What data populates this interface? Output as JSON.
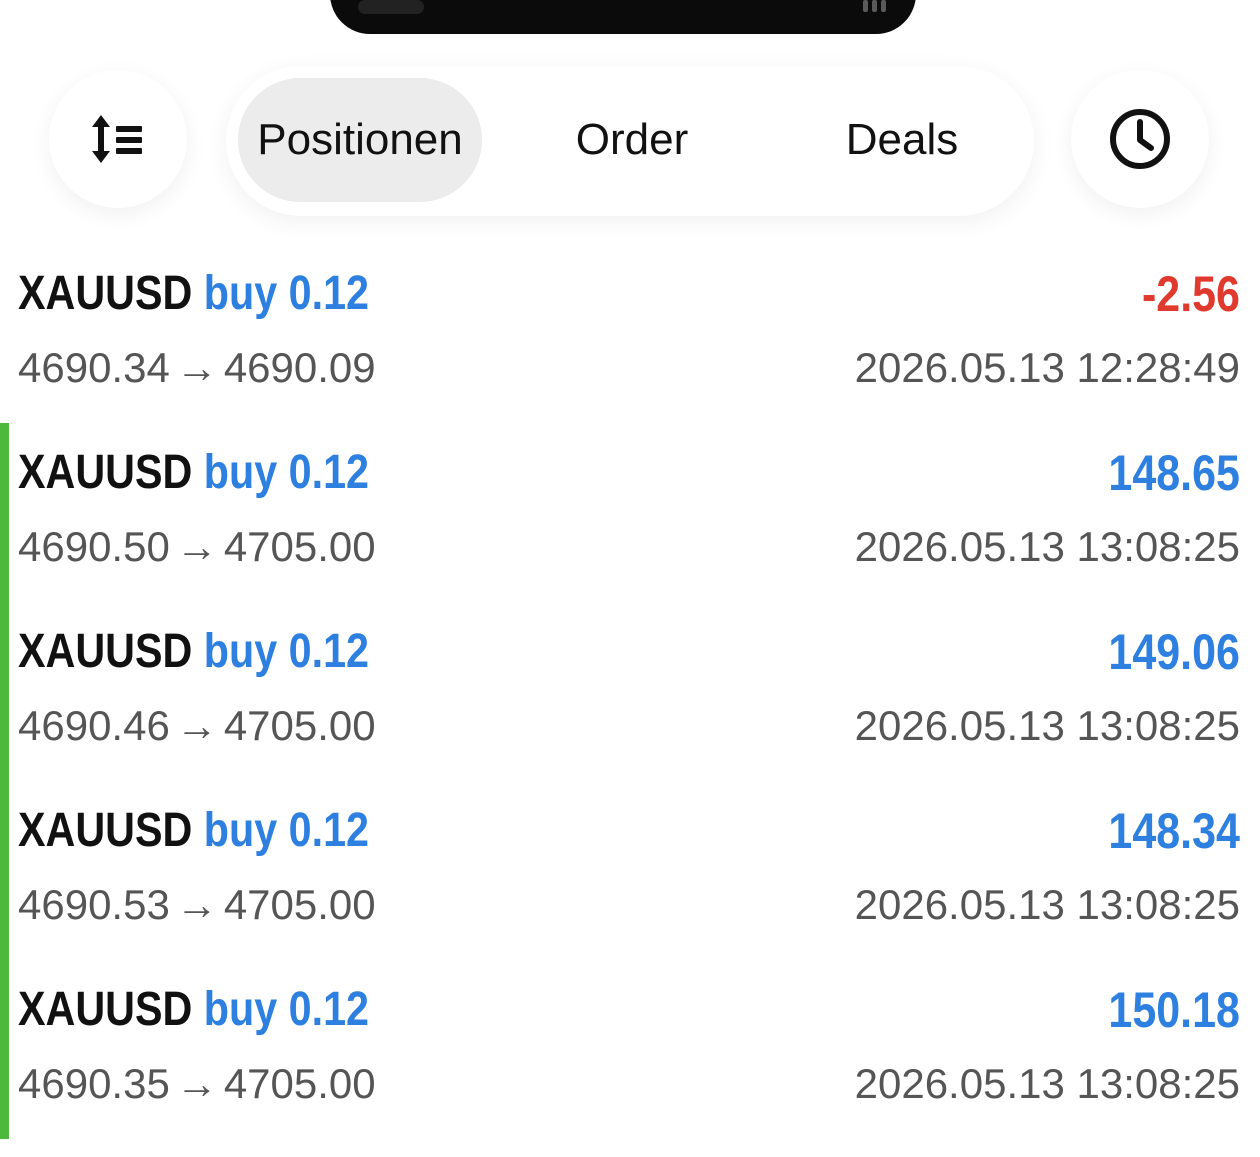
{
  "toolbar": {
    "sort_icon": "sort-list-icon",
    "history_icon": "clock-icon",
    "tabs": [
      {
        "label": "Positionen",
        "active": true
      },
      {
        "label": "Order",
        "active": false
      },
      {
        "label": "Deals",
        "active": false
      }
    ]
  },
  "colors": {
    "profit": "#2d7fe0",
    "loss": "#e03a2f",
    "marker": "#4cb83c"
  },
  "positions": [
    {
      "symbol": "XAUUSD",
      "side": "buy",
      "volume": "0.12",
      "open_price": "4690.34",
      "arrow": "→",
      "current_price": "4690.09",
      "time": "2026.05.13 12:28:49",
      "profit": "-2.56"
    },
    {
      "symbol": "XAUUSD",
      "side": "buy",
      "volume": "0.12",
      "open_price": "4690.50",
      "arrow": "→",
      "current_price": "4705.00",
      "time": "2026.05.13 13:08:25",
      "profit": "148.65"
    },
    {
      "symbol": "XAUUSD",
      "side": "buy",
      "volume": "0.12",
      "open_price": "4690.46",
      "arrow": "→",
      "current_price": "4705.00",
      "time": "2026.05.13 13:08:25",
      "profit": "149.06"
    },
    {
      "symbol": "XAUUSD",
      "side": "buy",
      "volume": "0.12",
      "open_price": "4690.53",
      "arrow": "→",
      "current_price": "4705.00",
      "time": "2026.05.13 13:08:25",
      "profit": "148.34"
    },
    {
      "symbol": "XAUUSD",
      "side": "buy",
      "volume": "0.12",
      "open_price": "4690.35",
      "arrow": "→",
      "current_price": "4705.00",
      "time": "2026.05.13 13:08:25",
      "profit": "150.18"
    }
  ]
}
